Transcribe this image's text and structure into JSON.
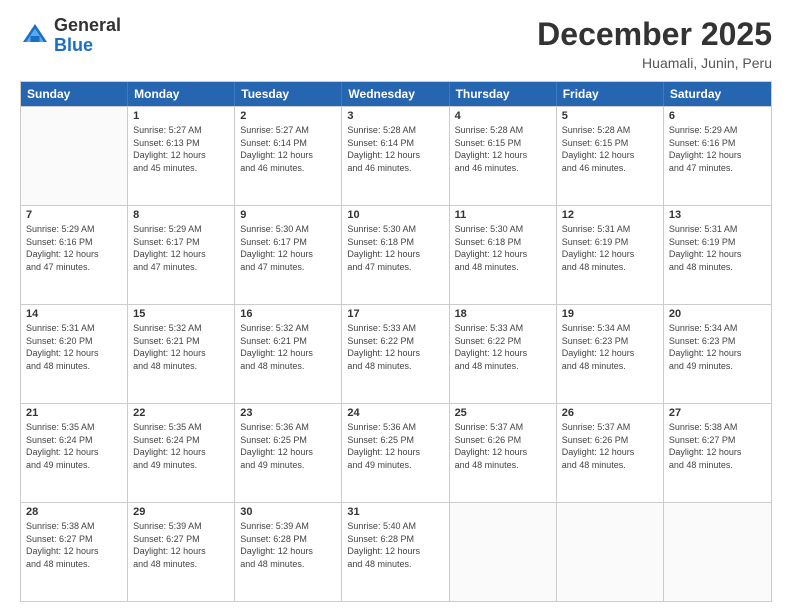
{
  "header": {
    "logo_general": "General",
    "logo_blue": "Blue",
    "month_year": "December 2025",
    "location": "Huamali, Junin, Peru"
  },
  "calendar": {
    "weekdays": [
      "Sunday",
      "Monday",
      "Tuesday",
      "Wednesday",
      "Thursday",
      "Friday",
      "Saturday"
    ],
    "rows": [
      [
        {
          "day": "",
          "info": ""
        },
        {
          "day": "1",
          "info": "Sunrise: 5:27 AM\nSunset: 6:13 PM\nDaylight: 12 hours\nand 45 minutes."
        },
        {
          "day": "2",
          "info": "Sunrise: 5:27 AM\nSunset: 6:14 PM\nDaylight: 12 hours\nand 46 minutes."
        },
        {
          "day": "3",
          "info": "Sunrise: 5:28 AM\nSunset: 6:14 PM\nDaylight: 12 hours\nand 46 minutes."
        },
        {
          "day": "4",
          "info": "Sunrise: 5:28 AM\nSunset: 6:15 PM\nDaylight: 12 hours\nand 46 minutes."
        },
        {
          "day": "5",
          "info": "Sunrise: 5:28 AM\nSunset: 6:15 PM\nDaylight: 12 hours\nand 46 minutes."
        },
        {
          "day": "6",
          "info": "Sunrise: 5:29 AM\nSunset: 6:16 PM\nDaylight: 12 hours\nand 47 minutes."
        }
      ],
      [
        {
          "day": "7",
          "info": "Sunrise: 5:29 AM\nSunset: 6:16 PM\nDaylight: 12 hours\nand 47 minutes."
        },
        {
          "day": "8",
          "info": "Sunrise: 5:29 AM\nSunset: 6:17 PM\nDaylight: 12 hours\nand 47 minutes."
        },
        {
          "day": "9",
          "info": "Sunrise: 5:30 AM\nSunset: 6:17 PM\nDaylight: 12 hours\nand 47 minutes."
        },
        {
          "day": "10",
          "info": "Sunrise: 5:30 AM\nSunset: 6:18 PM\nDaylight: 12 hours\nand 47 minutes."
        },
        {
          "day": "11",
          "info": "Sunrise: 5:30 AM\nSunset: 6:18 PM\nDaylight: 12 hours\nand 48 minutes."
        },
        {
          "day": "12",
          "info": "Sunrise: 5:31 AM\nSunset: 6:19 PM\nDaylight: 12 hours\nand 48 minutes."
        },
        {
          "day": "13",
          "info": "Sunrise: 5:31 AM\nSunset: 6:19 PM\nDaylight: 12 hours\nand 48 minutes."
        }
      ],
      [
        {
          "day": "14",
          "info": "Sunrise: 5:31 AM\nSunset: 6:20 PM\nDaylight: 12 hours\nand 48 minutes."
        },
        {
          "day": "15",
          "info": "Sunrise: 5:32 AM\nSunset: 6:21 PM\nDaylight: 12 hours\nand 48 minutes."
        },
        {
          "day": "16",
          "info": "Sunrise: 5:32 AM\nSunset: 6:21 PM\nDaylight: 12 hours\nand 48 minutes."
        },
        {
          "day": "17",
          "info": "Sunrise: 5:33 AM\nSunset: 6:22 PM\nDaylight: 12 hours\nand 48 minutes."
        },
        {
          "day": "18",
          "info": "Sunrise: 5:33 AM\nSunset: 6:22 PM\nDaylight: 12 hours\nand 48 minutes."
        },
        {
          "day": "19",
          "info": "Sunrise: 5:34 AM\nSunset: 6:23 PM\nDaylight: 12 hours\nand 48 minutes."
        },
        {
          "day": "20",
          "info": "Sunrise: 5:34 AM\nSunset: 6:23 PM\nDaylight: 12 hours\nand 49 minutes."
        }
      ],
      [
        {
          "day": "21",
          "info": "Sunrise: 5:35 AM\nSunset: 6:24 PM\nDaylight: 12 hours\nand 49 minutes."
        },
        {
          "day": "22",
          "info": "Sunrise: 5:35 AM\nSunset: 6:24 PM\nDaylight: 12 hours\nand 49 minutes."
        },
        {
          "day": "23",
          "info": "Sunrise: 5:36 AM\nSunset: 6:25 PM\nDaylight: 12 hours\nand 49 minutes."
        },
        {
          "day": "24",
          "info": "Sunrise: 5:36 AM\nSunset: 6:25 PM\nDaylight: 12 hours\nand 49 minutes."
        },
        {
          "day": "25",
          "info": "Sunrise: 5:37 AM\nSunset: 6:26 PM\nDaylight: 12 hours\nand 48 minutes."
        },
        {
          "day": "26",
          "info": "Sunrise: 5:37 AM\nSunset: 6:26 PM\nDaylight: 12 hours\nand 48 minutes."
        },
        {
          "day": "27",
          "info": "Sunrise: 5:38 AM\nSunset: 6:27 PM\nDaylight: 12 hours\nand 48 minutes."
        }
      ],
      [
        {
          "day": "28",
          "info": "Sunrise: 5:38 AM\nSunset: 6:27 PM\nDaylight: 12 hours\nand 48 minutes."
        },
        {
          "day": "29",
          "info": "Sunrise: 5:39 AM\nSunset: 6:27 PM\nDaylight: 12 hours\nand 48 minutes."
        },
        {
          "day": "30",
          "info": "Sunrise: 5:39 AM\nSunset: 6:28 PM\nDaylight: 12 hours\nand 48 minutes."
        },
        {
          "day": "31",
          "info": "Sunrise: 5:40 AM\nSunset: 6:28 PM\nDaylight: 12 hours\nand 48 minutes."
        },
        {
          "day": "",
          "info": ""
        },
        {
          "day": "",
          "info": ""
        },
        {
          "day": "",
          "info": ""
        }
      ]
    ]
  }
}
